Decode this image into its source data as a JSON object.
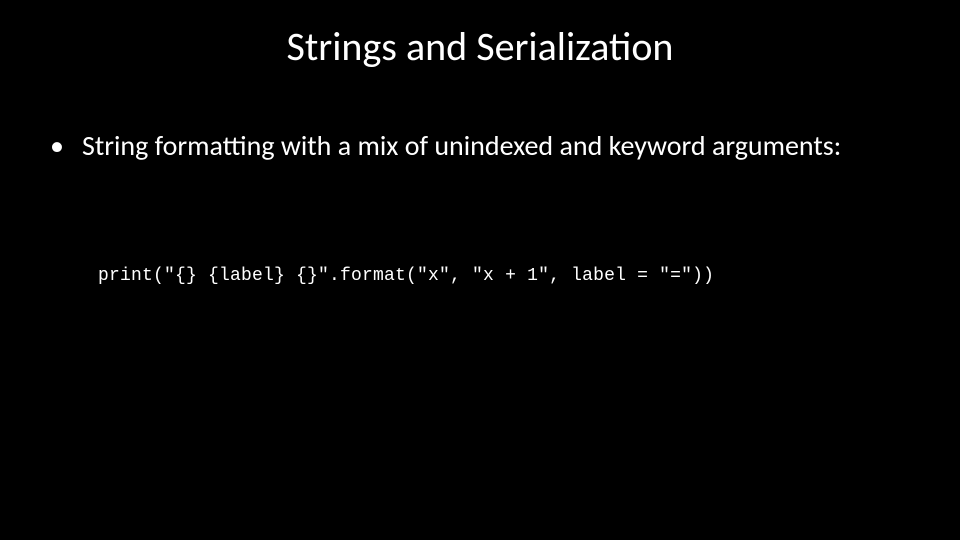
{
  "slide": {
    "title": "Strings and Serialization",
    "bullet_mark": "•",
    "bullet_text": "String formatting with a mix of unindexed and keyword arguments:",
    "code_line": "print(\"{} {label} {}\".format(\"x\", \"x + 1\", label = \"=\"))"
  }
}
